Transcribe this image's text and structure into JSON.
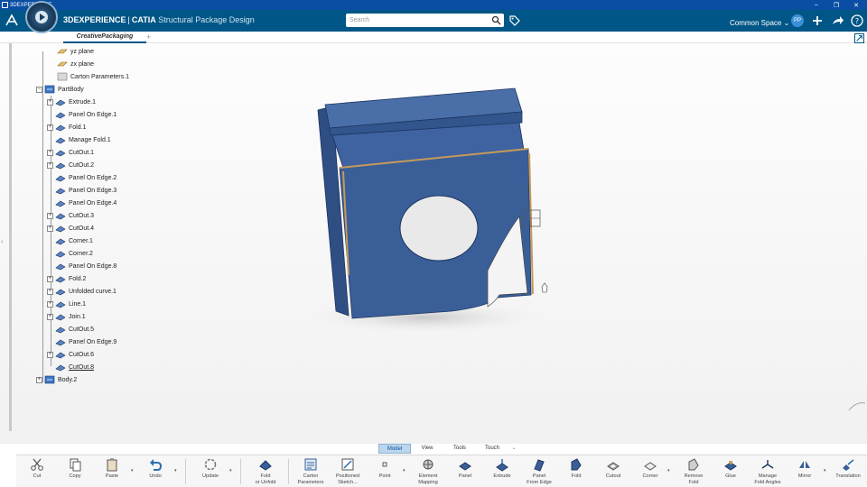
{
  "window": {
    "title": "3DEXPERIENCE"
  },
  "header": {
    "brand_strong": "3DEXPERIENCE",
    "brand_sep": "|",
    "brand_catia": "CATIA",
    "app_name": "Structural Package Design",
    "search_placeholder": "Search",
    "space_label": "Common Space",
    "avatar_initials": "PP"
  },
  "tabs": {
    "active": "CreativePackaging",
    "add": "+"
  },
  "tree": {
    "nodes": [
      "yz plane",
      "zx plane",
      "Carton Parameters.1",
      "PartBody",
      "Extrude.1",
      "Panel On Edge.1",
      "Fold.1",
      "Manage Fold.1",
      "CutOut.1",
      "CutOut.2",
      "Panel On Edge.2",
      "Panel On Edge.3",
      "Panel On Edge.4",
      "CutOut.3",
      "CutOut.4",
      "Corner.1",
      "Corner.2",
      "Panel On Edge.8",
      "Fold.2",
      "Unfolded curve.1",
      "Line.1",
      "Join.1",
      "CutOut.5",
      "Panel On Edge.9",
      "CutOut.6",
      "CutOut.8",
      "Body.2"
    ]
  },
  "ribbon": {
    "tabs": [
      "Model",
      "View",
      "Tools",
      "Touch"
    ],
    "active_tab": "Model",
    "tools": {
      "cut": "Cut",
      "copy": "Copy",
      "paste": "Paste",
      "undo": "Undo",
      "update": "Update",
      "fold_1": "Fold",
      "fold_2": "or Unfold",
      "carton_1": "Carton",
      "carton_2": "Parameters",
      "possketch_1": "Positioned",
      "possketch_2": "Sketch...",
      "point": "Point",
      "elemmap_1": "Element",
      "elemmap_2": "Mapping",
      "panel": "Panel",
      "extrude": "Extrude",
      "pfe_1": "Panel",
      "pfe_2": "From Edge",
      "fold": "Fold",
      "cutout": "Cutout",
      "corner": "Corner",
      "removefold_1": "Remove",
      "removefold_2": "Fold",
      "glue": "Glue",
      "mfa_1": "Manage",
      "mfa_2": "Fold Angles",
      "mirror": "Mirror",
      "translation": "Translation"
    }
  },
  "colors": {
    "header": "#005686",
    "titlebar": "#0a4ea3",
    "model_blue": "#3a5f98"
  }
}
